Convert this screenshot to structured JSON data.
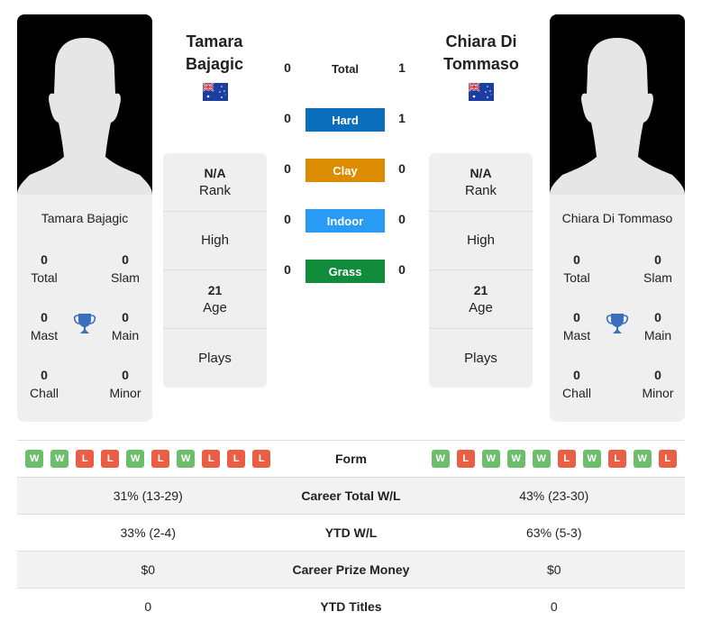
{
  "colors": {
    "hard": "#0a6ebd",
    "clay": "#dc8c00",
    "indoor": "#2a9bf5",
    "grass": "#118c3a",
    "win": "#6cbd6c",
    "loss": "#ea5e45",
    "trophy": "#3a6fbd"
  },
  "player1": {
    "name": "Tamara Bajagic",
    "name_line1": "Tamara",
    "name_line2": "Bajagic",
    "flag": "australia-flag",
    "rank_value": "N/A",
    "rank_label": "Rank",
    "high_label": "High",
    "age_value": "21",
    "age_label": "Age",
    "plays_label": "Plays",
    "titles": {
      "total": "0",
      "total_label": "Total",
      "slam": "0",
      "slam_label": "Slam",
      "mast": "0",
      "mast_label": "Mast",
      "main": "0",
      "main_label": "Main",
      "chall": "0",
      "chall_label": "Chall",
      "minor": "0",
      "minor_label": "Minor"
    },
    "form": [
      "W",
      "W",
      "L",
      "L",
      "W",
      "L",
      "W",
      "L",
      "L",
      "L"
    ],
    "career_wl": "31% (13-29)",
    "ytd_wl": "33% (2-4)",
    "prize_money": "$0",
    "ytd_titles": "0"
  },
  "player2": {
    "name": "Chiara Di Tommaso",
    "name_line1": "Chiara Di",
    "name_line2": "Tommaso",
    "flag": "australia-flag",
    "rank_value": "N/A",
    "rank_label": "Rank",
    "high_label": "High",
    "age_value": "21",
    "age_label": "Age",
    "plays_label": "Plays",
    "titles": {
      "total": "0",
      "total_label": "Total",
      "slam": "0",
      "slam_label": "Slam",
      "mast": "0",
      "mast_label": "Mast",
      "main": "0",
      "main_label": "Main",
      "chall": "0",
      "chall_label": "Chall",
      "minor": "0",
      "minor_label": "Minor"
    },
    "form": [
      "W",
      "L",
      "W",
      "W",
      "W",
      "L",
      "W",
      "L",
      "W",
      "L"
    ],
    "career_wl": "43% (23-30)",
    "ytd_wl": "63% (5-3)",
    "prize_money": "$0",
    "ytd_titles": "0"
  },
  "h2h": {
    "total": {
      "label": "Total",
      "p1": "0",
      "p2": "1"
    },
    "surfaces": [
      {
        "label": "Hard",
        "p1": "0",
        "p2": "1"
      },
      {
        "label": "Clay",
        "p1": "0",
        "p2": "0"
      },
      {
        "label": "Indoor",
        "p1": "0",
        "p2": "0"
      },
      {
        "label": "Grass",
        "p1": "0",
        "p2": "0"
      }
    ]
  },
  "comparison": {
    "form_label": "Form",
    "career_wl_label": "Career Total W/L",
    "ytd_wl_label": "YTD W/L",
    "prize_label": "Career Prize Money",
    "ytd_titles_label": "YTD Titles"
  }
}
